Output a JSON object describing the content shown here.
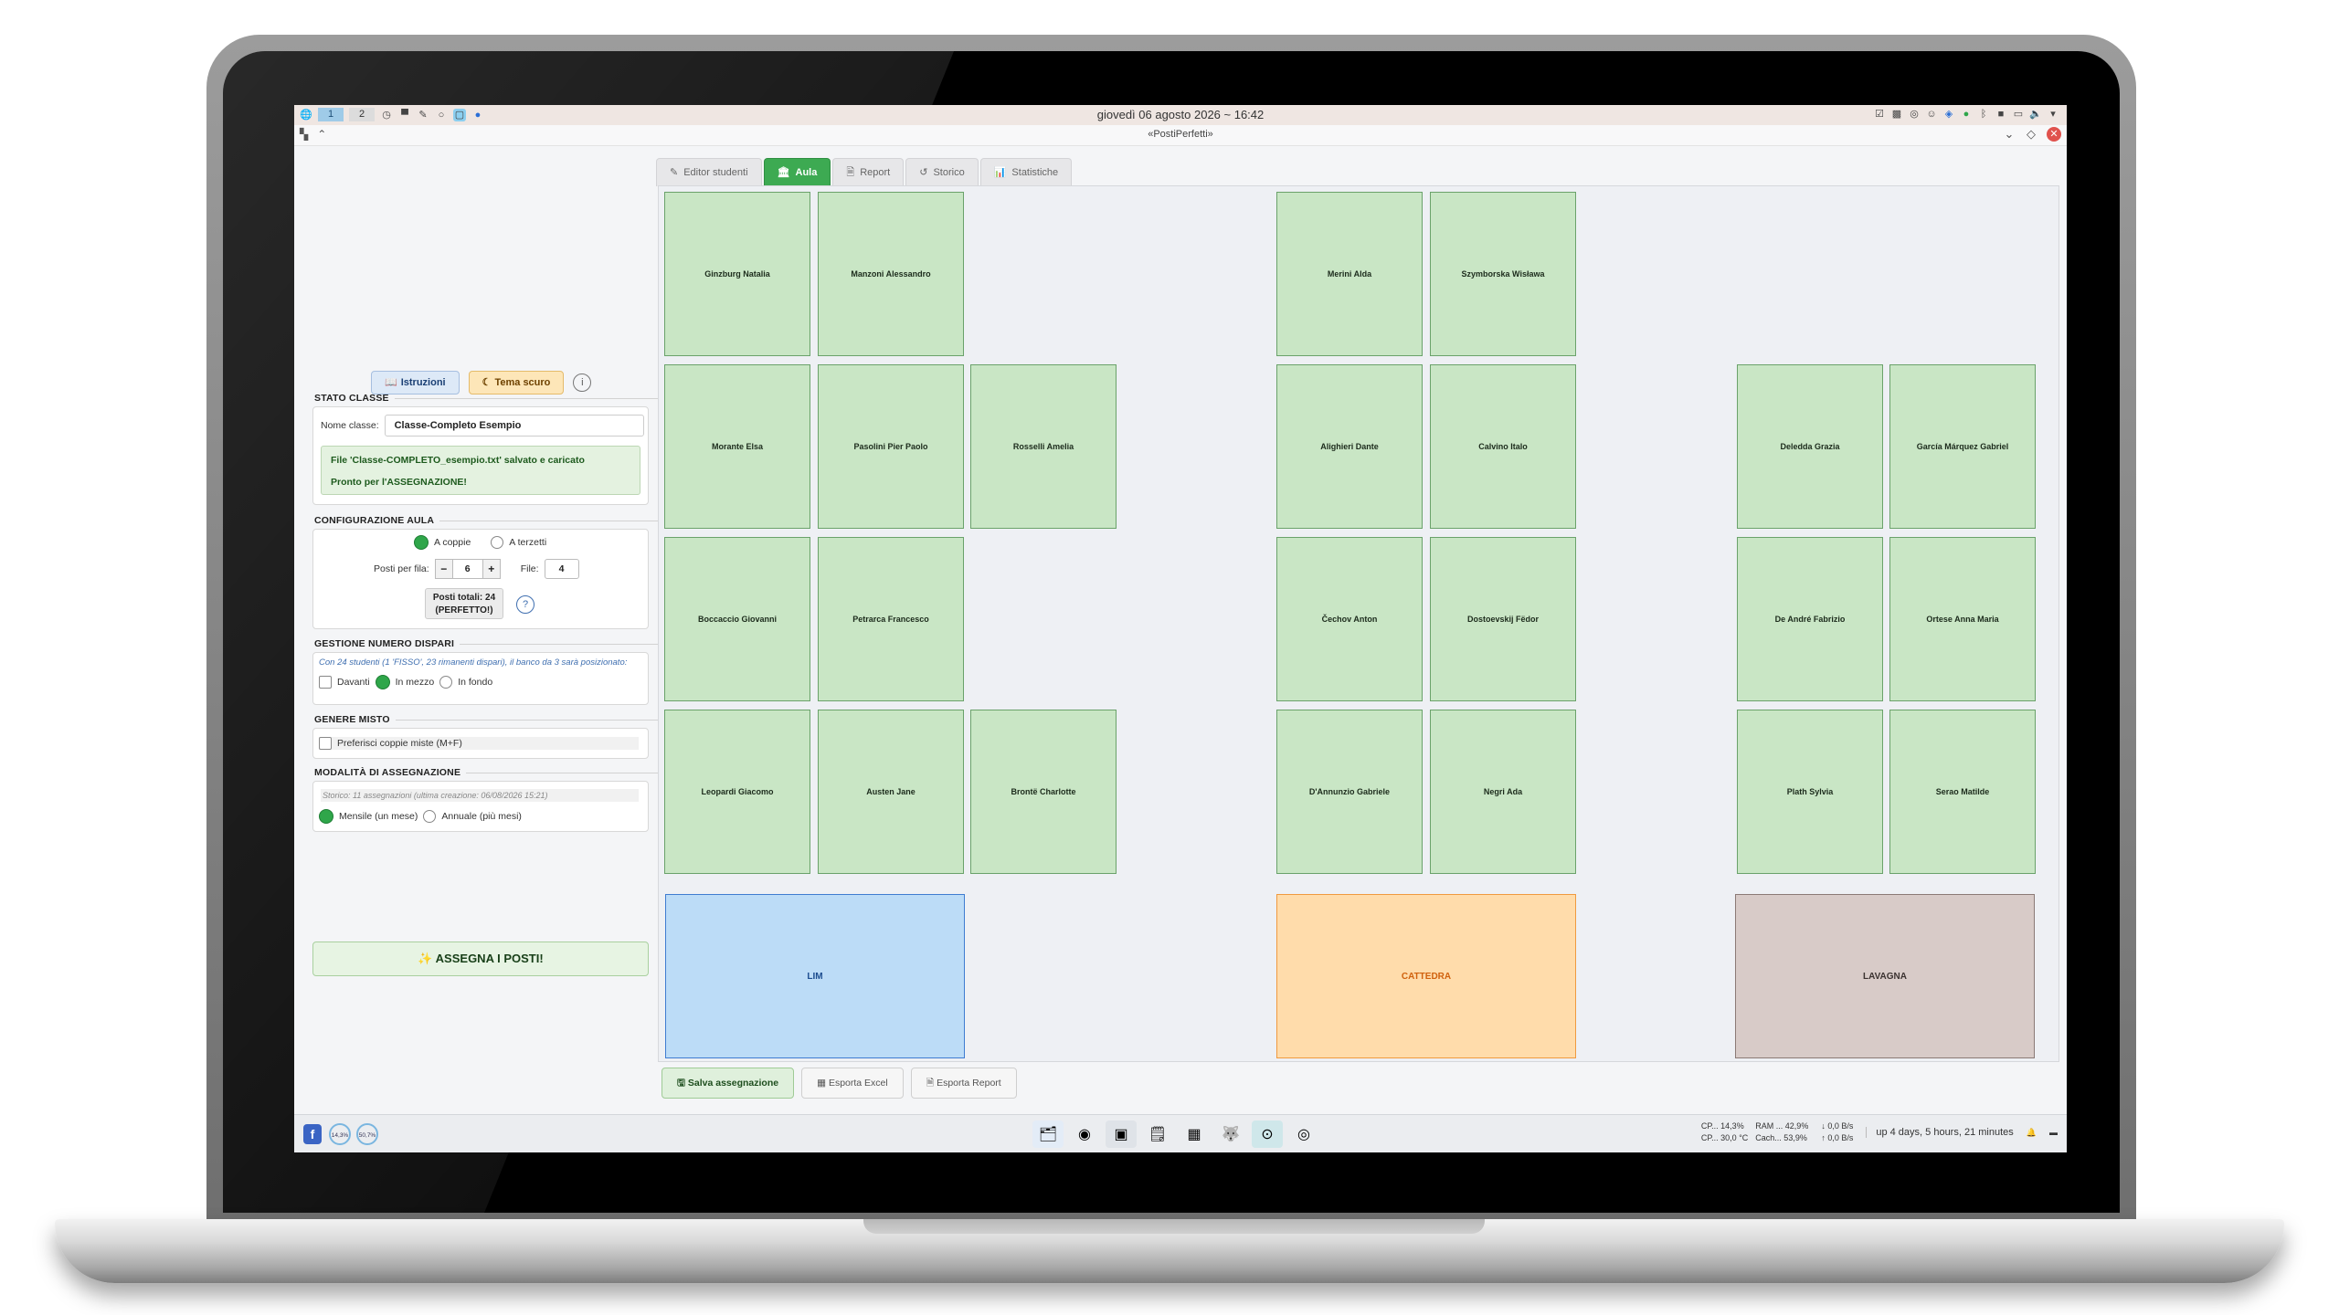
{
  "top_panel": {
    "workspaces": [
      "1",
      "2"
    ],
    "clock": "giovedì 06 agosto 2026 ~ 16:42"
  },
  "window": {
    "title": "«PostiPerfetti»"
  },
  "left_panel": {
    "buttons": {
      "instructions": "Istruzioni",
      "dark_theme": "Tema scuro",
      "info": "i"
    },
    "stato_classe": {
      "title": "STATO CLASSE",
      "class_name_label": "Nome classe:",
      "class_name_value": "Classe-Completo Esempio",
      "status_line1": "File 'Classe-COMPLETO_esempio.txt' salvato e caricato",
      "status_line2": "Pronto per l'ASSEGNAZIONE!"
    },
    "configurazione": {
      "title": "CONFIGURAZIONE AULA",
      "option_pairs": "A coppie",
      "option_triples": "A terzetti",
      "seats_per_row_label": "Posti per fila:",
      "seats_per_row_value": "6",
      "rows_label": "File:",
      "rows_value": "4",
      "total_line1": "Posti totali: 24",
      "total_line2": "(PERFETTO!)",
      "help": "?"
    },
    "dispari": {
      "title": "GESTIONE NUMERO DISPARI",
      "note": "Con 24 studenti (1 'FISSO', 23 rimanenti dispari), il banco da 3 sarà posizionato:",
      "opt_front": "Davanti",
      "opt_middle": "In mezzo",
      "opt_back": "In fondo"
    },
    "genere": {
      "title": "GENERE MISTO",
      "option": "Preferisci coppie miste (M+F)"
    },
    "modalita": {
      "title": "MODALITÀ DI ASSEGNAZIONE",
      "history": "Storico: 11 assegnazioni (ultima creazione: 06/08/2026 15:21)",
      "opt_monthly": "Mensile (un mese)",
      "opt_yearly": "Annuale (più mesi)"
    },
    "assign_button": "ASSEGNA I POSTI!"
  },
  "tabs": [
    {
      "label": "Editor studenti",
      "icon": "edit-icon"
    },
    {
      "label": "Aula",
      "icon": "classroom-icon",
      "active": true
    },
    {
      "label": "Report",
      "icon": "document-icon"
    },
    {
      "label": "Storico",
      "icon": "history-icon"
    },
    {
      "label": "Statistiche",
      "icon": "chart-icon"
    }
  ],
  "seats": [
    "Ginzburg Natalia",
    "Manzoni Alessandro",
    "Merini Alda",
    "Szymborska Wisława",
    "Morante Elsa",
    "Pasolini Pier Paolo",
    "Rosselli Amelia",
    "Alighieri Dante",
    "Calvino Italo",
    "Deledda Grazia",
    "García Márquez Gabriel",
    "Boccaccio Giovanni",
    "Petrarca Francesco",
    "Čechov Anton",
    "Dostoevskij Fëdor",
    "De André Fabrizio",
    "Ortese Anna Maria",
    "Leopardi Giacomo",
    "Austen Jane",
    "Brontë Charlotte",
    "D'Annunzio Gabriele",
    "Negri Ada",
    "Plath Sylvia",
    "Serao Matilde"
  ],
  "furniture": {
    "lim": "LIM",
    "cattedra": "CATTEDRA",
    "lavagna": "LAVAGNA"
  },
  "bottom_buttons": {
    "save": "Salva assegnazione",
    "export_excel": "Esporta Excel",
    "export_report": "Esporta Report"
  },
  "taskbar": {
    "gauge1": "14,3%",
    "gauge2": "50,7%",
    "cpu1": "CP... 14,3%",
    "cpu2": "CP... 30,0 °C",
    "ram1": "RAM ... 42,9%",
    "ram2": "Cach... 53,9%",
    "net_down": "↓ 0,0 B/s",
    "net_up": "↑ 0,0 B/s",
    "uptime": "up 4 days, 5 hours, 21 minutes"
  },
  "colors": {
    "accent_green": "#3daa52",
    "seat_fill": "#c9e6c5",
    "lim_fill": "#bcdcf7",
    "cattedra_fill": "#ffdcab",
    "lavagna_fill": "#d8cbc8"
  }
}
